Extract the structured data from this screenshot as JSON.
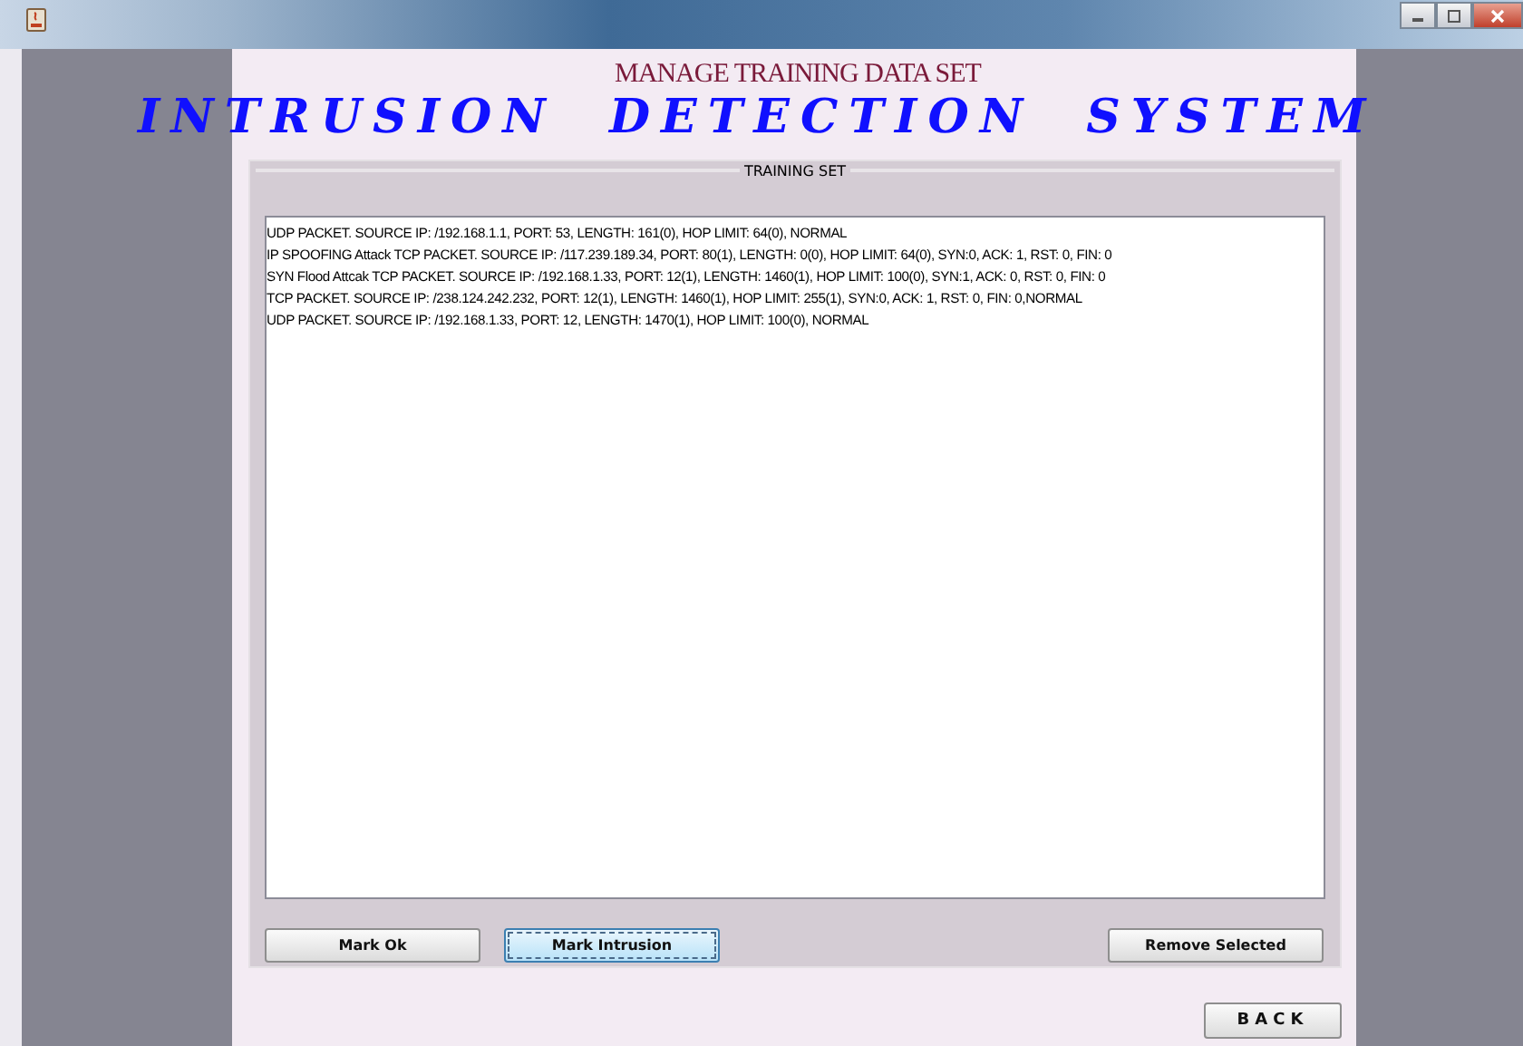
{
  "app_title": "INTRUSION DETECTION SYSTEM",
  "page_title": "MANAGE TRAINING DATA SET",
  "training_set": {
    "title": "TRAINING SET",
    "rows": [
      {
        "text": "UDP PACKET. SOURCE IP: /192.168.1.1, PORT: 53, LENGTH: 161(0), HOP LIMIT: 64(0), NORMAL"
      },
      {
        "text": "IP SPOOFING Attack  TCP PACKET. SOURCE IP: /117.239.189.34, PORT: 80(1), LENGTH: 0(0), HOP LIMIT: 64(0), SYN:0, ACK: 1, RST: 0, FIN: 0"
      },
      {
        "text": " SYN Flood Attcak  TCP PACKET. SOURCE IP: /192.168.1.33, PORT: 12(1), LENGTH: 1460(1), HOP LIMIT: 100(0), SYN:1, ACK: 0, RST: 0, FIN: 0"
      },
      {
        "text": "TCP PACKET. SOURCE IP: /238.124.242.232, PORT: 12(1), LENGTH: 1460(1), HOP LIMIT: 255(1), SYN:0, ACK: 1, RST: 0, FIN: 0,NORMAL"
      },
      {
        "text": "UDP PACKET. SOURCE IP: /192.168.1.33, PORT: 12, LENGTH: 1470(1), HOP LIMIT: 100(0), NORMAL"
      }
    ],
    "buttons": [
      {
        "label": "Mark Ok",
        "focused": false
      },
      {
        "label": "Mark Intrusion",
        "focused": true
      },
      {
        "label": "Remove Selected",
        "focused": false
      }
    ]
  },
  "back_button": {
    "label": "BACK"
  }
}
